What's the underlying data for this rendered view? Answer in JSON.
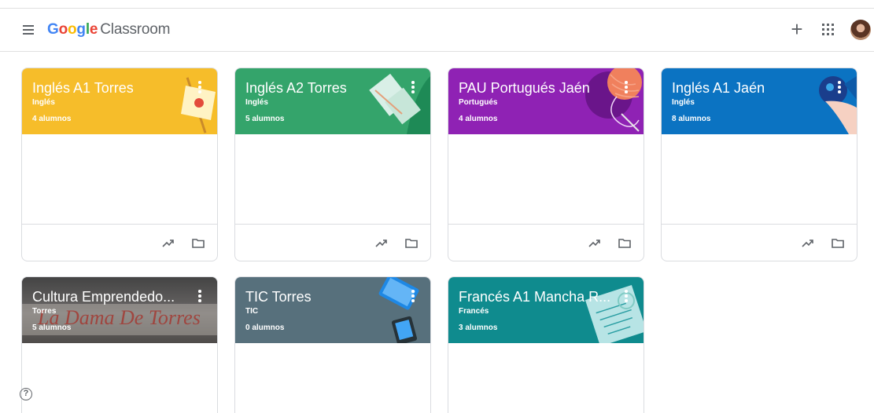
{
  "header": {
    "logo_google": "Google",
    "logo_product": "Classroom",
    "add_label": "+"
  },
  "help_label": "?",
  "classes": [
    {
      "title": "Inglés A1 Torres",
      "subject": "Inglés",
      "students": "4 alumnos",
      "color": "#f6bd2a"
    },
    {
      "title": "Inglés A2 Torres",
      "subject": "Inglés",
      "students": "5 alumnos",
      "color": "#34a46b"
    },
    {
      "title": "PAU Portugués Jaén",
      "subject": "Portugués",
      "students": "4 alumnos",
      "color": "#8f22b4"
    },
    {
      "title": "Inglés A1 Jaén",
      "subject": "Inglés",
      "students": "8 alumnos",
      "color": "#0b73c2"
    },
    {
      "title": "Cultura Emprendedo...",
      "subject": "Torres",
      "students": "5 alumnos",
      "color": "#5a5756",
      "image_text": "La Dama De Torres"
    },
    {
      "title": "TIC Torres",
      "subject": "TIC",
      "students": "0 alumnos",
      "color": "#57707c"
    },
    {
      "title": "Francés A1 Mancha R...",
      "subject": "Francés",
      "students": "3 alumnos",
      "color": "#0f8b8e"
    }
  ]
}
